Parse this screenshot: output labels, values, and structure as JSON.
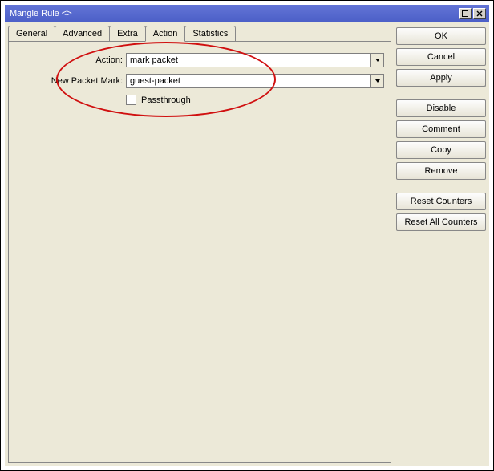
{
  "window": {
    "title": "Mangle Rule <>"
  },
  "tabs": {
    "general": "General",
    "advanced": "Advanced",
    "extra": "Extra",
    "action": "Action",
    "statistics": "Statistics"
  },
  "form": {
    "action_label": "Action:",
    "action_value": "mark packet",
    "mark_label": "New Packet Mark:",
    "mark_value": "guest-packet",
    "passthrough_label": "Passthrough"
  },
  "buttons": {
    "ok": "OK",
    "cancel": "Cancel",
    "apply": "Apply",
    "disable": "Disable",
    "comment": "Comment",
    "copy": "Copy",
    "remove": "Remove",
    "reset_counters": "Reset Counters",
    "reset_all": "Reset All Counters"
  }
}
